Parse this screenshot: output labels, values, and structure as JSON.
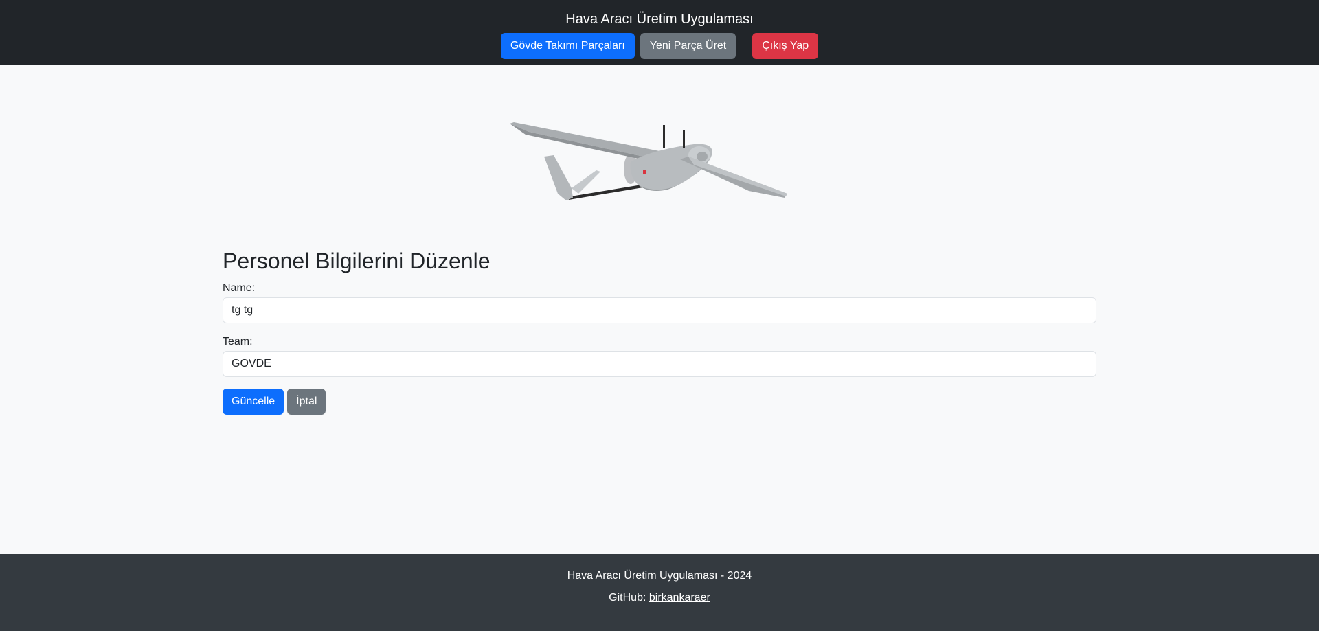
{
  "navbar": {
    "title": "Hava Aracı Üretim Uygulaması",
    "buttons": [
      {
        "label": "Gövde Takımı Parçaları",
        "variant": "primary"
      },
      {
        "label": "Yeni Parça Üret",
        "variant": "secondary"
      },
      {
        "label": "Çıkış Yap",
        "variant": "danger"
      }
    ]
  },
  "hero": {
    "image": "drone-image"
  },
  "form": {
    "title": "Personel Bilgilerini Düzenle",
    "name_label": "Name:",
    "name_value": "tg tg",
    "team_label": "Team:",
    "team_value": "GOVDE",
    "submit_label": "Güncelle",
    "cancel_label": "İptal"
  },
  "footer": {
    "copyright": "Hava Aracı Üretim Uygulaması - 2024",
    "github_prefix": "GitHub:",
    "github_link": "birkankaraer"
  },
  "colors": {
    "navbar_bg": "#212529",
    "footer_bg": "#343a40",
    "primary": "#0d6efd",
    "secondary": "#6c757d",
    "danger": "#dc3545",
    "page_bg": "#f8f9fa"
  }
}
